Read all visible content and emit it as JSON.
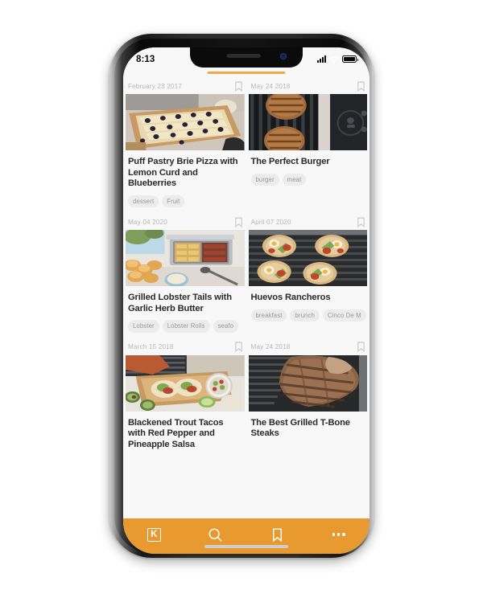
{
  "device": {
    "status_bar": {
      "time": "8:13",
      "signal_icon": "cellular-signal-icon",
      "wifi_icon": "wifi-icon",
      "battery_icon": "battery-full-icon"
    },
    "home_indicator": "home-indicator"
  },
  "app": {
    "accent_color": "#e8992f",
    "tab_indicator_color": "#efa94a",
    "background_color": "#f8f8f8",
    "tag_background_color": "#ececec",
    "title_color": "#2a2a2a",
    "date_color": "#b7b7b7"
  },
  "feed": {
    "rows": [
      {
        "cards": [
          {
            "date": "February 23 2017",
            "bookmark_icon": "bookmark-outline-icon",
            "title": "Puff Pastry Brie Pizza with Lemon Curd and Blueberries",
            "image_alt": "puff-pastry-brie-pizza-photo",
            "tags": [
              "dessert",
              "Fruit"
            ]
          },
          {
            "date": "May 24 2018",
            "bookmark_icon": "bookmark-outline-icon",
            "title": "The Perfect Burger",
            "image_alt": "burger-patties-on-grill-photo",
            "tags": [
              "burger",
              "meat"
            ]
          }
        ]
      },
      {
        "cards": [
          {
            "date": "May 04 2020",
            "bookmark_icon": "bookmark-outline-icon",
            "title": "Grilled Lobster Tails with Garlic Herb Butter",
            "image_alt": "grilled-lobster-tails-photo",
            "tags": [
              "Lobster",
              "Lobster Rolls",
              "seafo"
            ]
          },
          {
            "date": "April 07 2020",
            "bookmark_icon": "bookmark-outline-icon",
            "title": "Huevos Rancheros",
            "image_alt": "huevos-rancheros-on-grill-photo",
            "tags": [
              "breakfast",
              "brunch",
              "Cinco De M"
            ]
          }
        ]
      },
      {
        "cards": [
          {
            "date": "March 15 2018",
            "bookmark_icon": "bookmark-outline-icon",
            "title": "Blackened Trout Tacos with Red Pepper and Pineapple Salsa",
            "image_alt": "blackened-trout-tacos-photo",
            "tags": []
          },
          {
            "date": "May 24 2018",
            "bookmark_icon": "bookmark-outline-icon",
            "title": "The Best Grilled T-Bone Steaks",
            "image_alt": "grilled-t-bone-steaks-photo",
            "tags": []
          }
        ]
      }
    ]
  },
  "bottom_nav": {
    "items": [
      {
        "name": "home-logo",
        "label": "K",
        "icon": "k-logo-icon"
      },
      {
        "name": "search",
        "label": "",
        "icon": "search-icon"
      },
      {
        "name": "bookmarks",
        "label": "",
        "icon": "bookmark-outline-icon"
      },
      {
        "name": "more",
        "label": "",
        "icon": "more-horizontal-icon"
      }
    ]
  }
}
